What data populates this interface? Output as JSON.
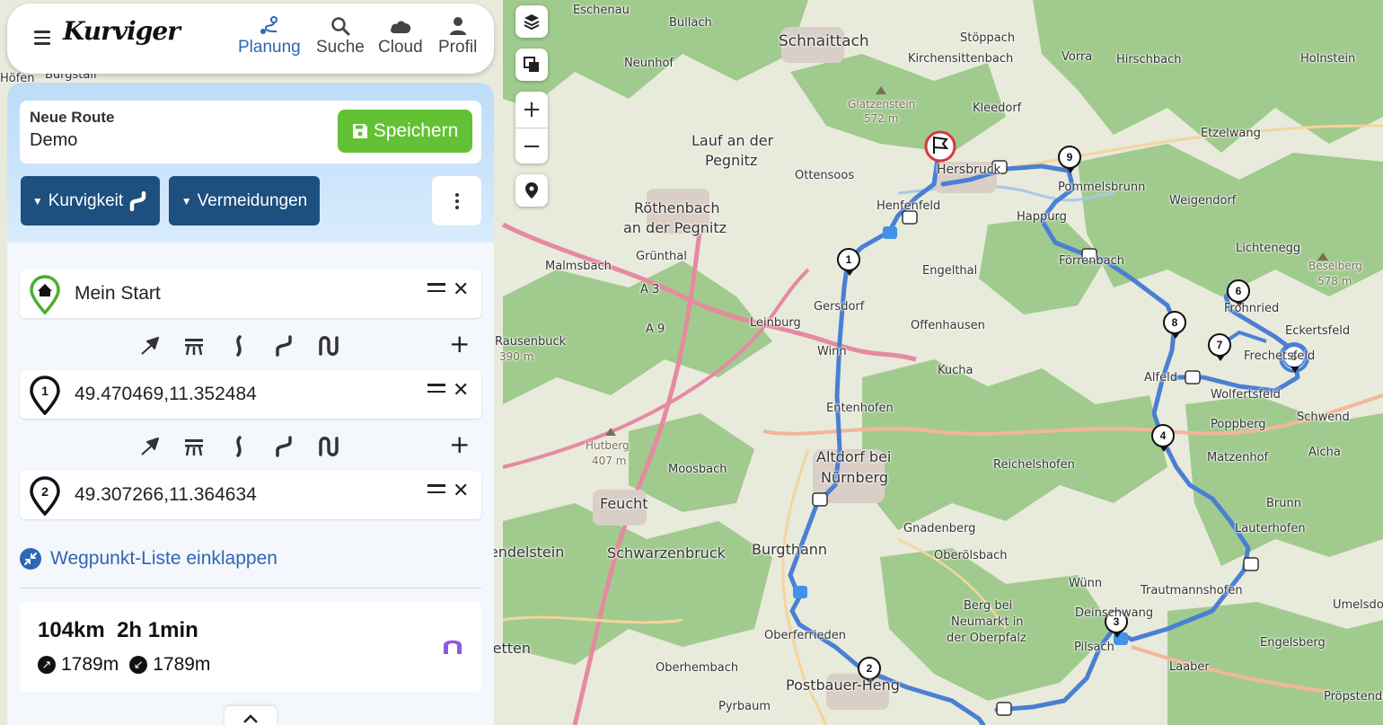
{
  "app": {
    "logo": "Kurviger"
  },
  "nav": [
    {
      "label": "Planung",
      "icon": "route-icon",
      "active": true
    },
    {
      "label": "Suche",
      "icon": "search-icon"
    },
    {
      "label": "Cloud",
      "icon": "cloud-icon"
    },
    {
      "label": "Profil",
      "icon": "user-icon"
    }
  ],
  "route": {
    "label": "Neue Route",
    "name": "Demo",
    "save_label": "Speichern"
  },
  "options": {
    "curviness_label": "Kurvigkeit",
    "avoid_label": "Vermeidungen"
  },
  "waypoints": [
    {
      "marker": "home",
      "text": "Mein Start"
    },
    {
      "marker": "1",
      "text": "49.470469,11.352484"
    },
    {
      "marker": "2",
      "text": "49.307266,11.364634"
    }
  ],
  "collapse_label": "Wegpunkt-Liste einklappen",
  "stats": {
    "distance": "104km",
    "duration": "2h 1min",
    "ascent": "1789m",
    "descent": "1789m"
  },
  "map": {
    "places": [
      "Eschenau",
      "Bullach",
      "Schnaittach",
      "Stöppach",
      "Kirchensittenbach",
      "Vorra",
      "Hirschbach",
      "Holnstein",
      "Neunhof",
      "Glatzenstein",
      "572 m",
      "Kleedorf",
      "Etzelwang",
      "Lauf an der",
      "Pegnitz",
      "Ottensoos",
      "Hersbruck",
      "Pommelsbrunn",
      "Weigendorf",
      "Röthenbach",
      "an der Pegnitz",
      "Henfenfeld",
      "Happurg",
      "Lichtenegg",
      "Malmsbach",
      "Grünthal",
      "Förrenbach",
      "Beselberg",
      "578 m",
      "A 3",
      "Engelthal",
      "Frohnried",
      "Eckertsfeld",
      "Gersdorf",
      "Leinburg",
      "Offenhausen",
      "A 9",
      "Rausenbuck",
      "390 m",
      "Winn",
      "Frechetsfeld",
      "Kucha",
      "Alfeld",
      "Wolfertsfeld",
      "Schwend",
      "Poppberg",
      "Entenhofen",
      "Hutberg",
      "407 m",
      "Altdorf bei",
      "Nürnberg",
      "Reichelshofen",
      "Matzenhof",
      "Aicha",
      "Moosbach",
      "Feucht",
      "Brunn",
      "Gnadenberg",
      "Lauterhofen",
      "Burgthann",
      "Schwarzenbruck",
      "Wendelstein",
      "Oberölsbach",
      "Wünn",
      "Trautmannshofen",
      "Umelsdorf",
      "Berg bei",
      "Neumarkt in",
      "der Oberpfalz",
      "Deinschwang",
      "Oberferrieden",
      "Pilsach",
      "Engelsberg",
      "Letten",
      "Oberhembach",
      "Postbauer-Heng",
      "Laaber",
      "Pyrbaum",
      "Pröpstendorf",
      "Burgstall",
      "Höfen"
    ]
  }
}
